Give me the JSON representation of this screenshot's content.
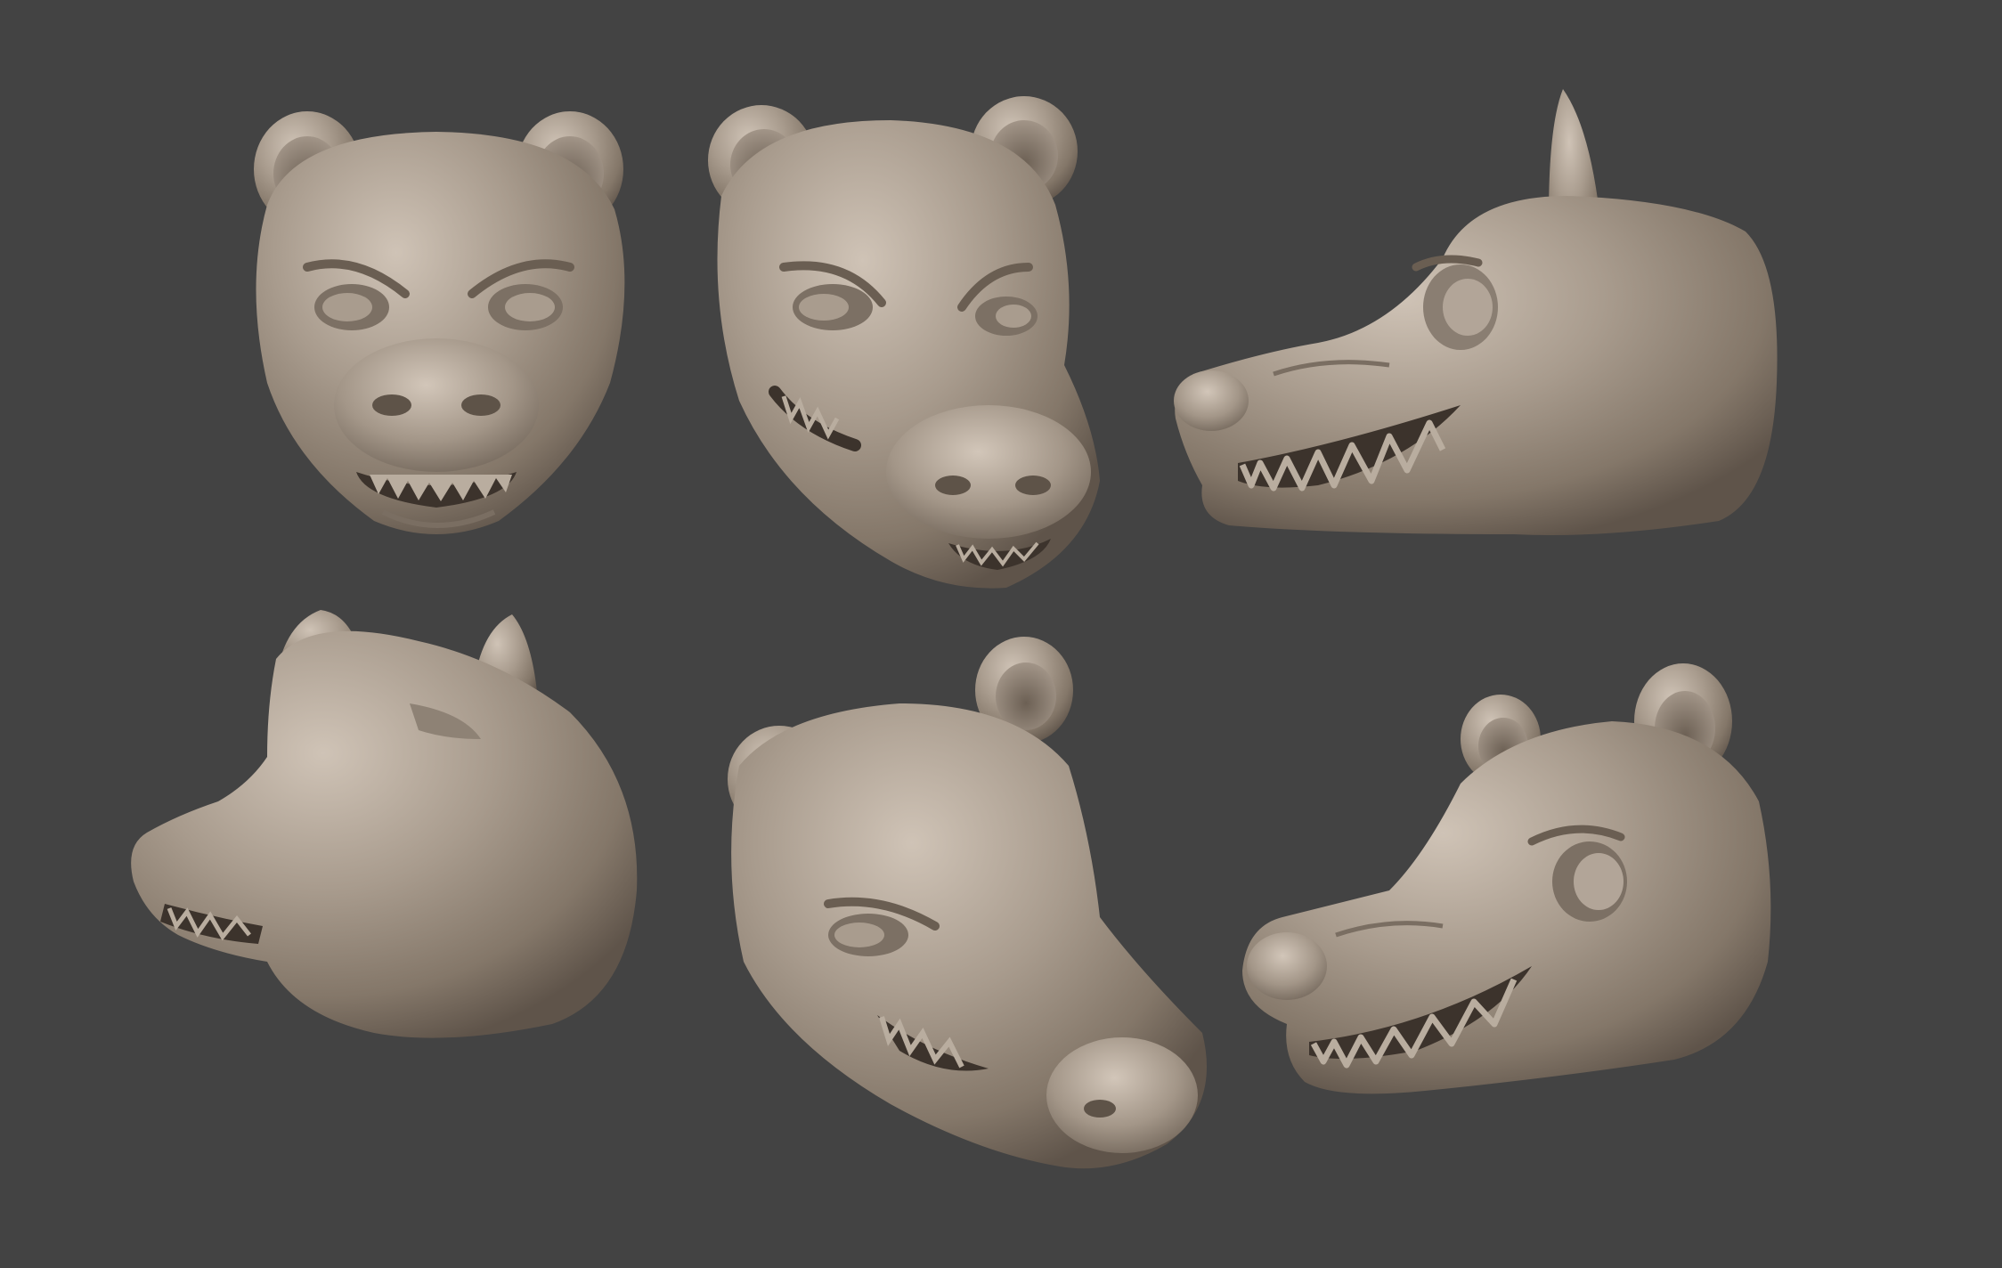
{
  "scene": {
    "background_color": "#434343",
    "material_colors": {
      "base": "#9a8d80",
      "highlight": "#c9bdb0",
      "shadow": "#5a4f45",
      "mouth": "#3c332c",
      "teeth": "#b9ad9f"
    },
    "views": [
      {
        "id": "front",
        "row": 1,
        "col": 1
      },
      {
        "id": "three-quarter-front",
        "row": 1,
        "col": 2
      },
      {
        "id": "side-left",
        "row": 1,
        "col": 3
      },
      {
        "id": "back-three-quarter",
        "row": 2,
        "col": 1
      },
      {
        "id": "low-three-quarter",
        "row": 2,
        "col": 2
      },
      {
        "id": "three-quarter-left",
        "row": 2,
        "col": 3
      }
    ]
  }
}
